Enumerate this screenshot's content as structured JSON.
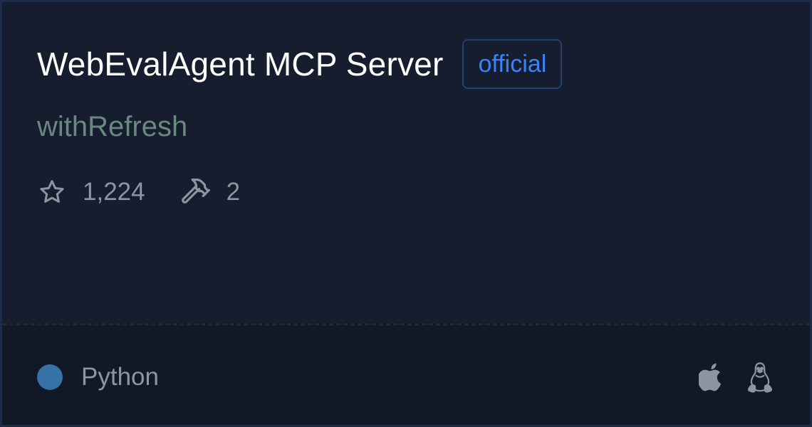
{
  "card": {
    "title": "WebEvalAgent MCP Server",
    "badge": "official",
    "author": "withRefresh",
    "stats": {
      "stars": "1,224",
      "tools": "2",
      "star_icon": "star-icon",
      "tools_icon": "hammer-icon"
    },
    "footer": {
      "language": "Python",
      "language_color": "#3572A5",
      "platforms": [
        "apple-icon",
        "linux-icon"
      ]
    }
  }
}
